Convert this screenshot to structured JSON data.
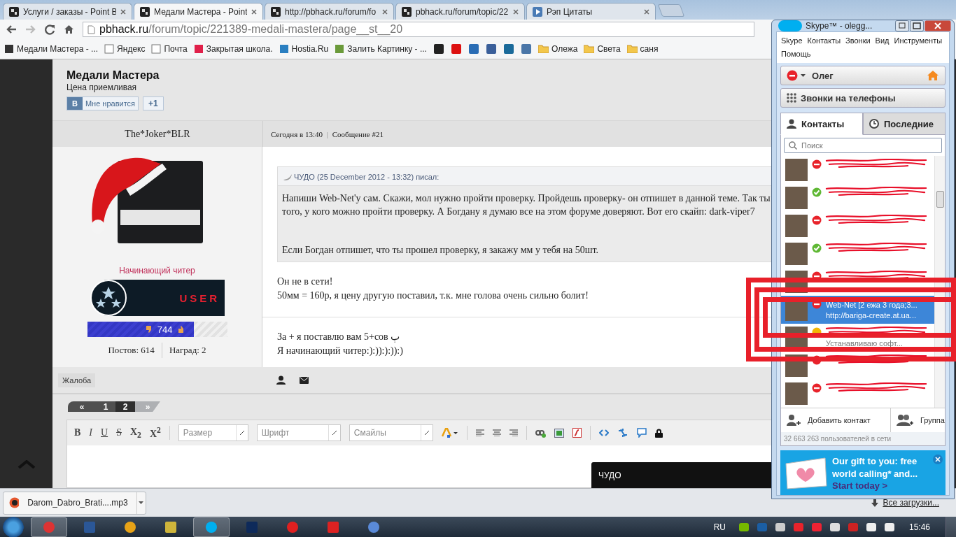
{
  "browser": {
    "tabs": [
      {
        "title": "Услуги / заказы - Point B",
        "kind": "pb",
        "selected": false
      },
      {
        "title": "Медали Мастера - Point",
        "kind": "pb",
        "selected": true
      },
      {
        "title": "http://pbhack.ru/forum/fo",
        "kind": "pb",
        "selected": false
      },
      {
        "title": "pbhack.ru/forum/topic/22",
        "kind": "pb",
        "selected": false
      },
      {
        "title": "Рэп Цитаты",
        "kind": "video",
        "selected": false
      }
    ],
    "address": {
      "host": "pbhack.ru",
      "path": "/forum/topic/221389-medali-mastera/page__st__20"
    },
    "bookmarks": [
      {
        "label": "Медали Мастера - ...",
        "kind": "pb"
      },
      {
        "label": "Яндекс",
        "kind": "page"
      },
      {
        "label": "Почта",
        "kind": "page"
      },
      {
        "label": "Закрытая школа.",
        "kind": "tv"
      },
      {
        "label": "Hostia.Ru",
        "kind": "hostia"
      },
      {
        "label": "Залить Картинку - ...",
        "kind": "image"
      }
    ],
    "folders": [
      "Олежа",
      "Света",
      "саня"
    ]
  },
  "topic": {
    "title": "Медали Мастера",
    "subtitle": "Цена приемливая",
    "like": {
      "vk_letter": "В",
      "text": "Мне нравится",
      "plus": "+1"
    }
  },
  "post": {
    "author": "The*Joker*BLR",
    "date": "Сегодня в 13:40",
    "separator": "|",
    "number": "Сообщение #21",
    "group": "Начинающий читер",
    "rank": "USER",
    "reputation": {
      "value": "744",
      "level": 0.76
    },
    "posts": "Постов: 614",
    "awards": "Наград: 2",
    "quote": {
      "header": "ЧУДО (25 December 2012 - 13:32) писал:",
      "lines": [
        "Напиши Web-Net'у сам. Скажи, мол нужно пройти проверку. Пройдешь проверку- он отпишет в данной теме. Так ты",
        "того, у кого можно пройти проверку. А Богдану я думаю все на этом форуме доверяют. Вот его скайп: dark-viper7"
      ],
      "last": "Если Богдан отпишет, что ты прошел проверку, я закажу мм у тебя на 50шт."
    },
    "reply": [
      "Он не в сети!",
      "50мм = 160р, я цену другую поставил, т.к. мне голова очень сильно болит!"
    ],
    "signature": [
      "За + я поставлю вам 5+сов ٻ",
      "Я начинающий читер:):)):):)):)"
    ],
    "report": "Жалоба"
  },
  "pagination": [
    {
      "label": "«",
      "selected": false
    },
    {
      "label": "1",
      "selected": false
    },
    {
      "label": "2",
      "selected": true
    },
    {
      "label": "»",
      "selected": false
    }
  ],
  "editor": {
    "format_buttons": [
      {
        "label": "B",
        "kind": "bold"
      },
      {
        "label": "I",
        "kind": "italic"
      },
      {
        "label": "U",
        "kind": "underline"
      },
      {
        "label": "S",
        "kind": "strike"
      },
      {
        "label": "X$_{2}$",
        "kind": "sub"
      },
      {
        "label": "X$^{2}$",
        "kind": "sup"
      }
    ],
    "dropdowns": [
      "Размер",
      "Шрифт",
      "Смайлы"
    ],
    "tooltip": "ЧУДО"
  },
  "download": {
    "file": "Darom_Dabro_Brati....mp3",
    "all": "Все загрузки..."
  },
  "taskbar": {
    "language": "RU",
    "clock": "15:46"
  },
  "skype": {
    "title": "Skype™ - olegg...",
    "menu": [
      "Skype",
      "Контакты",
      "Звонки",
      "Вид",
      "Инструменты",
      "Помощь"
    ],
    "profile": "Олег",
    "phones": "Звонки на телефоны",
    "tabs": [
      {
        "label": "Контакты",
        "selected": true
      },
      {
        "label": "Последние",
        "selected": false
      }
    ],
    "search": {
      "placeholder": "Поиск"
    },
    "contacts": [
      {
        "kind": "busy",
        "scribbled": true,
        "selected": false
      },
      {
        "kind": "online",
        "scribbled": true,
        "selected": false
      },
      {
        "kind": "busy",
        "scribbled": true,
        "selected": false
      },
      {
        "kind": "online",
        "scribbled": true,
        "selected": false
      },
      {
        "kind": "busy",
        "scribbled": true,
        "selected": false
      },
      {
        "kind": "busy",
        "scribbled": false,
        "selected": true,
        "name": "Web-Net [2 ежа 3 года;3...",
        "mood": "http://bariga-create.at.ua..."
      },
      {
        "kind": "away",
        "scribbled": true,
        "selected": false,
        "mood": "Устанавливаю софт..."
      },
      {
        "kind": "busy",
        "scribbled": true,
        "selected": false
      },
      {
        "kind": "busy",
        "scribbled": true,
        "selected": false
      }
    ],
    "add_contact": "Добавить контакт",
    "group": "Группа",
    "online_count": "32 663 263 пользователей в сети",
    "ad": {
      "text": "Our gift to you: free world calling* and...",
      "link": "Start today >"
    }
  }
}
